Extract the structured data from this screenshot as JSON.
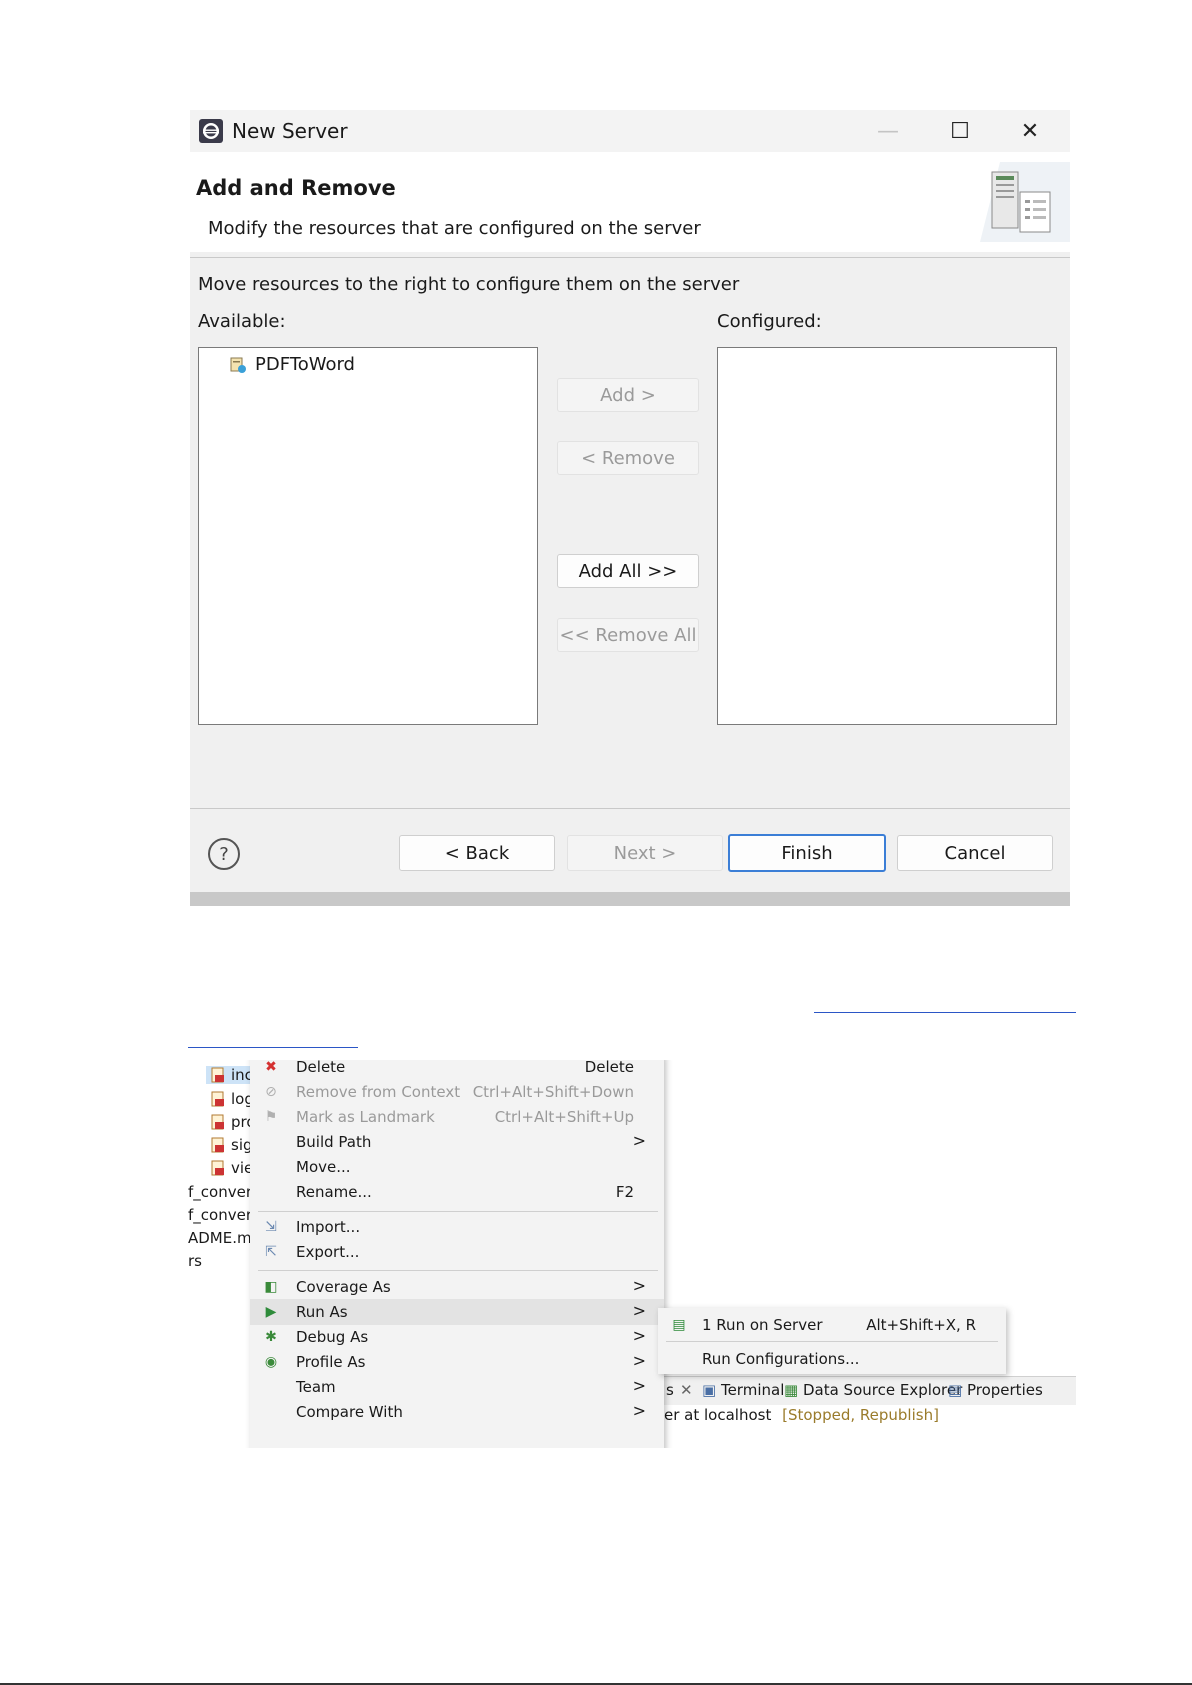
{
  "dialog": {
    "title": "New Server",
    "header_title": "Add and Remove",
    "header_subtitle": "Modify the resources that are configured on the server",
    "instruction": "Move resources to the right to configure them on the server",
    "available_label": "Available:",
    "configured_label": "Configured:",
    "available_items": [
      "PDFToWord"
    ],
    "buttons": {
      "add": "Add >",
      "remove": "< Remove",
      "add_all": "Add All >>",
      "remove_all": "<< Remove All",
      "back": "< Back",
      "next": "Next >",
      "finish": "Finish",
      "cancel": "Cancel",
      "help": "?"
    },
    "window_controls": {
      "minimize": "—",
      "maximize": "☐",
      "close": "✕"
    }
  },
  "context_screenshot": {
    "tree_items": [
      "inc",
      "log",
      "pro",
      "sig",
      "vie"
    ],
    "side_items": [
      "f_convert",
      "f_convert",
      "ADME.m",
      "rs"
    ],
    "menu": [
      {
        "label": "Delete",
        "shortcut": "Delete",
        "icon": "delete-x-icon",
        "disabled": false
      },
      {
        "label": "Remove from Context",
        "shortcut": "Ctrl+Alt+Shift+Down",
        "icon": "remove-context-icon",
        "disabled": true
      },
      {
        "label": "Mark as Landmark",
        "shortcut": "Ctrl+Alt+Shift+Up",
        "icon": "landmark-icon",
        "disabled": true
      },
      {
        "label": "Build Path",
        "shortcut": "",
        "arrow": ">",
        "disabled": false
      },
      {
        "label": "Move...",
        "shortcut": "",
        "disabled": false
      },
      {
        "label": "Rename...",
        "shortcut": "F2",
        "disabled": false
      },
      {
        "label": "Import...",
        "shortcut": "",
        "icon": "import-icon",
        "disabled": false
      },
      {
        "label": "Export...",
        "shortcut": "",
        "icon": "export-icon",
        "disabled": false
      },
      {
        "label": "Coverage As",
        "arrow": ">",
        "icon": "coverage-icon"
      },
      {
        "label": "Run As",
        "arrow": ">",
        "icon": "run-icon"
      },
      {
        "label": "Debug As",
        "arrow": ">",
        "icon": "debug-icon"
      },
      {
        "label": "Profile As",
        "arrow": ">",
        "icon": "profile-icon"
      },
      {
        "label": "Team",
        "arrow": ">"
      },
      {
        "label": "Compare With",
        "arrow": ">"
      }
    ],
    "submenu": [
      {
        "label": "1 Run on Server",
        "shortcut": "Alt+Shift+X, R",
        "icon": "run-on-server-icon"
      },
      {
        "label": "Run Configurations...",
        "shortcut": ""
      }
    ],
    "tabs": {
      "partial": "s",
      "close": "✕",
      "terminal": "Terminal",
      "data_source_explorer": "Data Source Explorer",
      "properties": "Properties"
    },
    "server_status_prefix": "er at localhost",
    "server_status": "[Stopped, Republish]",
    "colors": {
      "status": "#9a7b2b",
      "run_green": "#2e8b3a",
      "delete_red": "#d43030"
    }
  }
}
